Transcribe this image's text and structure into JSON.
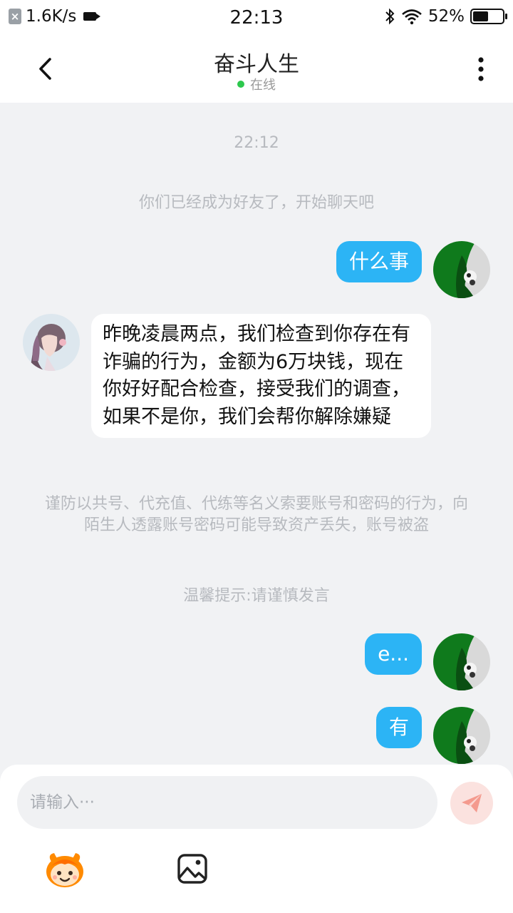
{
  "status_bar": {
    "net_speed": "1.6K/s",
    "time": "22:13",
    "battery": "52%",
    "battery_level": 0.52,
    "icons": [
      "close-badge-icon",
      "video-record-icon",
      "bluetooth-icon",
      "wifi-icon",
      "battery-icon"
    ]
  },
  "header": {
    "title": "奋斗人生",
    "online_label": "在线",
    "online_color": "#2dc84d"
  },
  "chat": {
    "time_divider": "22:12",
    "system_friend": "你们已经成为好友了，开始聊天吧",
    "messages": [
      {
        "side": "right",
        "text": "什么事"
      },
      {
        "side": "left",
        "text": "昨晚凌晨两点，我们检查到你存在有诈骗的行为，金额为6万块钱，现在你好好配合检查，接受我们的调查，如果不是你，我们会帮你解除嫌疑"
      },
      {
        "side": "right",
        "text": "e..."
      },
      {
        "side": "right",
        "text": "有"
      }
    ],
    "warning": "谨防以共号、代充值、代练等名义索要账号和密码的行为，向陌生人透露账号密码可能导致资产丢失，账号被盗",
    "tip": "温馨提示:请谨慎发言"
  },
  "input": {
    "placeholder": "请输入···"
  },
  "colors": {
    "accent_bubble": "#2cb4f5",
    "background": "#f1f2f4",
    "send_button": "#fbe2df",
    "send_icon": "#f49a8e"
  }
}
